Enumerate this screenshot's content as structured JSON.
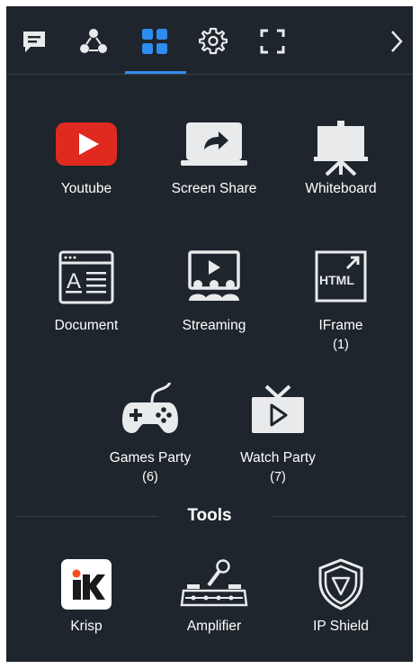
{
  "tabs": [
    {
      "name": "chat",
      "icon": "chat-icon"
    },
    {
      "name": "participants",
      "icon": "participants-icon"
    },
    {
      "name": "apps",
      "icon": "apps-grid-icon",
      "active": true
    },
    {
      "name": "settings",
      "icon": "gear-icon"
    },
    {
      "name": "fullscreen",
      "icon": "fullscreen-icon"
    },
    {
      "name": "collapse",
      "icon": "chevron-right-icon"
    }
  ],
  "apps": {
    "youtube": {
      "label": "Youtube"
    },
    "screen_share": {
      "label": "Screen Share"
    },
    "whiteboard": {
      "label": "Whiteboard"
    },
    "document": {
      "label": "Document"
    },
    "streaming": {
      "label": "Streaming"
    },
    "iframe": {
      "label": "IFrame",
      "count": "(1)"
    },
    "games_party": {
      "label": "Games Party",
      "count": "(6)"
    },
    "watch_party": {
      "label": "Watch Party",
      "count": "(7)"
    }
  },
  "tools": {
    "title": "Tools",
    "krisp": {
      "label": "Krisp"
    },
    "amplifier": {
      "label": "Amplifier"
    },
    "ip_shield": {
      "label": "IP Shield"
    }
  },
  "colors": {
    "panel_bg": "#1e252c",
    "accent": "#2f8cf0",
    "youtube_red": "#e02a20",
    "icon_light": "#e8eaec",
    "krisp_orange": "#f4511e"
  }
}
